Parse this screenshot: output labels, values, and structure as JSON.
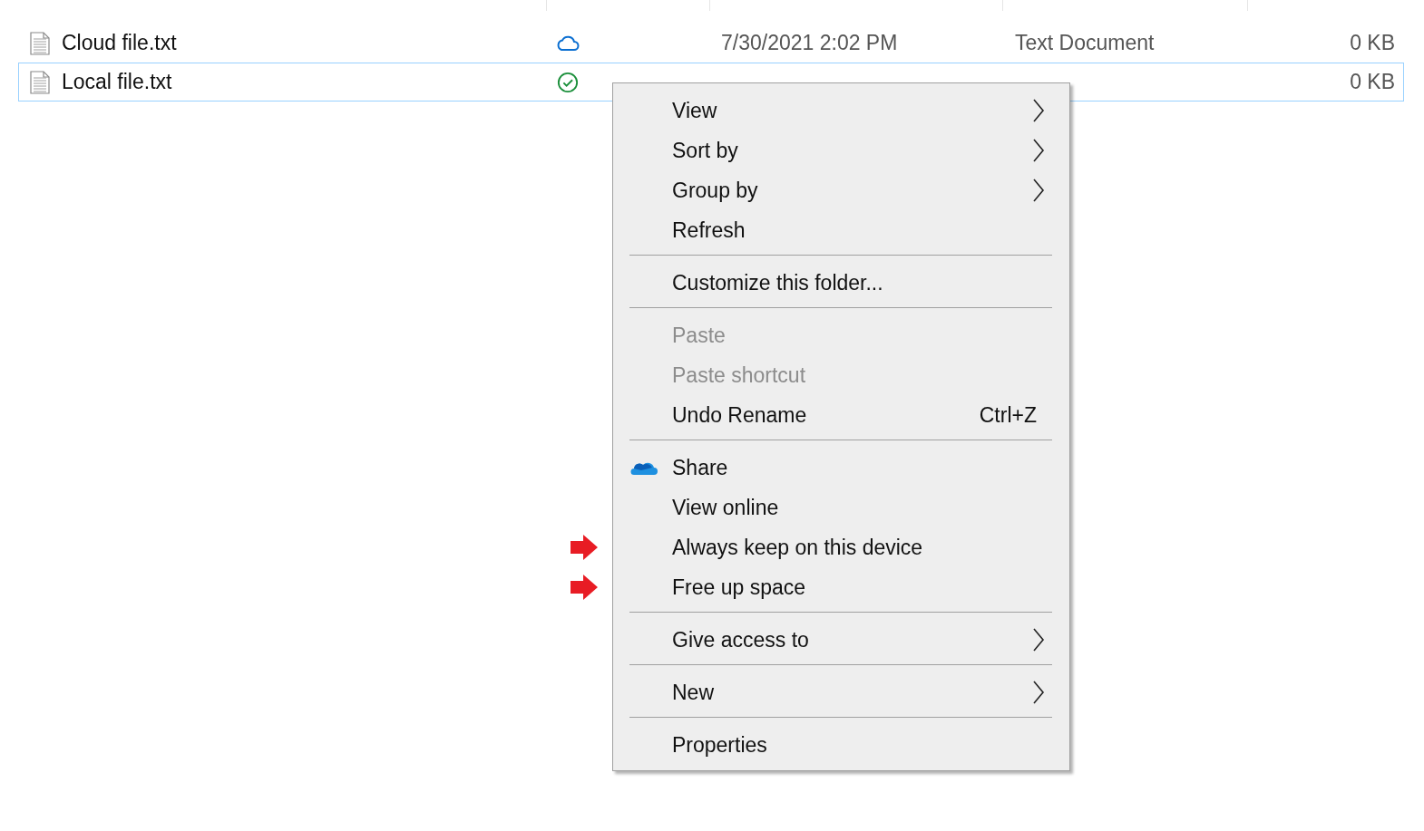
{
  "files": [
    {
      "name": "Cloud file.txt",
      "kind": "cloud",
      "date": "7/30/2021 2:02 PM",
      "type": "Text Document",
      "size": "0 KB",
      "selected": false
    },
    {
      "name": "Local file.txt",
      "kind": "local",
      "size": "0 KB",
      "selected": true
    }
  ],
  "context_menu": {
    "groups": [
      [
        {
          "label": "View",
          "submenu": true,
          "disabled": false,
          "has_icon": false
        },
        {
          "label": "Sort by",
          "submenu": true,
          "disabled": false,
          "has_icon": false
        },
        {
          "label": "Group by",
          "submenu": true,
          "disabled": false,
          "has_icon": false
        },
        {
          "label": "Refresh",
          "submenu": false,
          "disabled": false,
          "has_icon": false
        }
      ],
      [
        {
          "label": "Customize this folder...",
          "submenu": false,
          "disabled": false,
          "has_icon": false
        }
      ],
      [
        {
          "label": "Paste",
          "submenu": false,
          "disabled": true,
          "has_icon": false
        },
        {
          "label": "Paste shortcut",
          "submenu": false,
          "disabled": true,
          "has_icon": false
        },
        {
          "label": "Undo Rename",
          "shortcut": "Ctrl+Z",
          "submenu": false,
          "disabled": false,
          "has_icon": false
        }
      ],
      [
        {
          "label": "Share",
          "submenu": false,
          "disabled": false,
          "has_icon": true
        },
        {
          "label": "View online",
          "submenu": false,
          "disabled": false,
          "has_icon": false
        },
        {
          "label": "Always keep on this device",
          "submenu": false,
          "disabled": false,
          "marked": true,
          "has_icon": false
        },
        {
          "label": "Free up space",
          "submenu": false,
          "disabled": false,
          "marked": true,
          "has_icon": false
        }
      ],
      [
        {
          "label": "Give access to",
          "submenu": true,
          "disabled": false,
          "has_icon": false
        }
      ],
      [
        {
          "label": "New",
          "submenu": true,
          "disabled": false,
          "has_icon": false
        }
      ],
      [
        {
          "label": "Properties",
          "submenu": false,
          "disabled": false,
          "has_icon": false
        }
      ]
    ]
  }
}
